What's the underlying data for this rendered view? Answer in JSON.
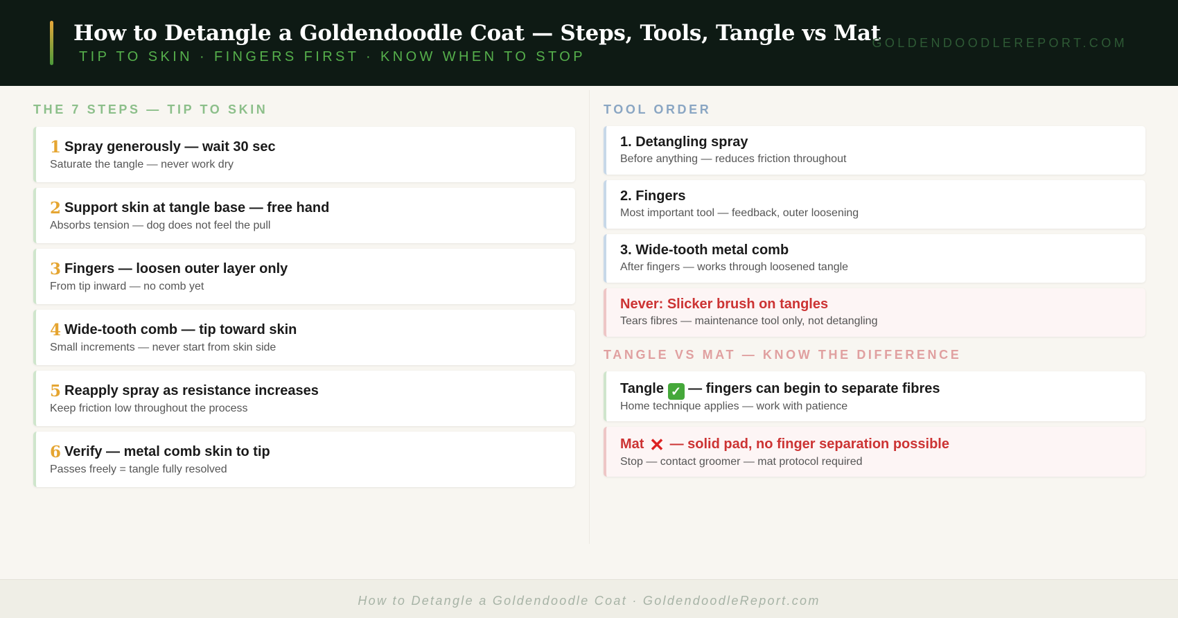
{
  "header": {
    "title": "How to Detangle a Goldendoodle Coat — Steps, Tools, Tangle vs Mat",
    "subtitle": "TIP TO SKIN · FINGERS FIRST · KNOW WHEN TO STOP",
    "site": "GOLDENDOODLEREPORT.COM"
  },
  "steps": {
    "title": "THE 7 STEPS — TIP TO SKIN",
    "items": [
      {
        "num": "1",
        "head": "Spray generously — wait 30 sec",
        "desc": "Saturate the tangle — never work dry"
      },
      {
        "num": "2",
        "head": "Support skin at tangle base — free hand",
        "desc": "Absorbs tension — dog does not feel the pull"
      },
      {
        "num": "3",
        "head": "Fingers — loosen outer layer only",
        "desc": "From tip inward — no comb yet"
      },
      {
        "num": "4",
        "head": "Wide-tooth comb — tip toward skin",
        "desc": "Small increments — never start from skin side"
      },
      {
        "num": "5",
        "head": "Reapply spray as resistance increases",
        "desc": "Keep friction low throughout the process"
      },
      {
        "num": "6",
        "head": "Verify — metal comb skin to tip",
        "desc": "Passes freely = tangle fully resolved"
      }
    ]
  },
  "tools": {
    "title": "TOOL ORDER",
    "items": [
      {
        "head": "1. Detangling spray",
        "desc": "Before anything — reduces friction throughout"
      },
      {
        "head": "2. Fingers",
        "desc": "Most important tool — feedback, outer loosening"
      },
      {
        "head": "3. Wide-tooth metal comb",
        "desc": "After fingers — works through loosened tangle"
      },
      {
        "head": "Never: Slicker brush on tangles",
        "desc": "Tears fibres — maintenance tool only, not detangling"
      }
    ]
  },
  "compare": {
    "title": "TANGLE VS MAT — KNOW THE DIFFERENCE",
    "tangle": {
      "prefix": "Tangle",
      "icon": "✓",
      "icon_name": "check-mark-icon",
      "suffix": "— fingers can begin to separate fibres",
      "desc": "Home technique applies — work with patience"
    },
    "mat": {
      "prefix": "Mat",
      "icon": "✕",
      "icon_name": "cross-mark-icon",
      "suffix": "— solid pad, no finger separation possible",
      "desc": "Stop — contact groomer — mat protocol required"
    }
  },
  "footer": {
    "text": "How to Detangle a Goldendoodle Coat · GoldendoodleReport.com"
  },
  "colors": {
    "header_bg": "#0e1a14",
    "step_number": "#e5a531",
    "warning_red": "#cc3333",
    "subtitle_green": "#56b04c"
  }
}
